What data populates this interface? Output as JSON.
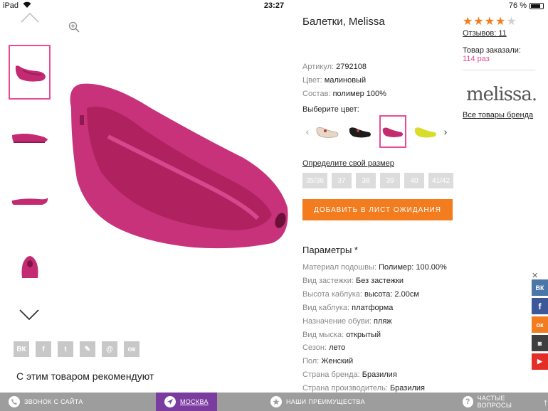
{
  "status_bar": {
    "device": "iPad",
    "time": "23:27",
    "battery": "76 %"
  },
  "product": {
    "title": "Балетки, Melissa",
    "props": [
      {
        "key": "Артикул:",
        "value": "2792108"
      },
      {
        "key": "Цвет:",
        "value": "малиновый"
      },
      {
        "key": "Состав:",
        "value": "полимер 100%"
      }
    ],
    "choose_color_label": "Выберите цвет:",
    "colors": [
      {
        "name": "beige",
        "color": "#e8d7c8"
      },
      {
        "name": "black",
        "color": "#1c1c1c"
      },
      {
        "name": "raspberry",
        "color": "#c42a72"
      },
      {
        "name": "yellow",
        "color": "#d8dd2a"
      }
    ],
    "size_link": "Определите свой размер",
    "sizes": [
      "35/36",
      "37",
      "38",
      "39",
      "40",
      "41/42"
    ],
    "waitlist_button": "ДОБАВИТЬ В ЛИСТ ОЖИДАНИЯ",
    "params_title": "Параметры *",
    "params": [
      {
        "key": "Материал подошвы:",
        "value": "Полимер: 100.00%"
      },
      {
        "key": "Вид застежки:",
        "value": "Без застежки"
      },
      {
        "key": "Высота каблука:",
        "value": "высота: 2.00см"
      },
      {
        "key": "Вид каблука:",
        "value": "платформа"
      },
      {
        "key": "Назначение обуви:",
        "value": "пляж"
      },
      {
        "key": "Вид мыска:",
        "value": "открытый"
      },
      {
        "key": "Сезон:",
        "value": "лето"
      },
      {
        "key": "Пол:",
        "value": "Женский"
      },
      {
        "key": "Страна бренда:",
        "value": "Бразилия"
      },
      {
        "key": "Страна производитель:",
        "value": "Бразилия"
      }
    ]
  },
  "rating": {
    "stars": 4,
    "max": 5,
    "reviews_label": "Отзывов: 11"
  },
  "ordered": {
    "text": "Товар заказали:",
    "count": "114",
    "unit": "раз"
  },
  "brand": {
    "logo_text": "melissa.",
    "all_link": "Все товары бренда"
  },
  "share_buttons": [
    "ВК",
    "f",
    "t",
    "✎",
    "@",
    "ок"
  ],
  "recommend_title": "С этим товаром рекомендуют",
  "social": [
    {
      "label": "ВК",
      "color": "#4a76a8"
    },
    {
      "label": "f",
      "color": "#3b5998"
    },
    {
      "label": "ок",
      "color": "#f27c1e"
    },
    {
      "label": "◙",
      "color": "#3f3f3f"
    },
    {
      "label": "▶",
      "color": "#e52d27"
    }
  ],
  "bottom_bar": [
    {
      "label": "ЗВОНОК С САЙТА",
      "icon": "phone-icon"
    },
    {
      "label": "МОСКВА",
      "icon": "location-icon"
    },
    {
      "label": "НАШИ ПРЕИМУЩЕСТВА",
      "icon": "star-icon"
    },
    {
      "label": "ЧАСТЫЕ ВОПРОСЫ",
      "icon": "question-icon"
    }
  ],
  "colors": {
    "accent": "#f27c1e",
    "pink": "#e84c98",
    "purple": "#7b3c9f",
    "product": "#c42a72"
  }
}
